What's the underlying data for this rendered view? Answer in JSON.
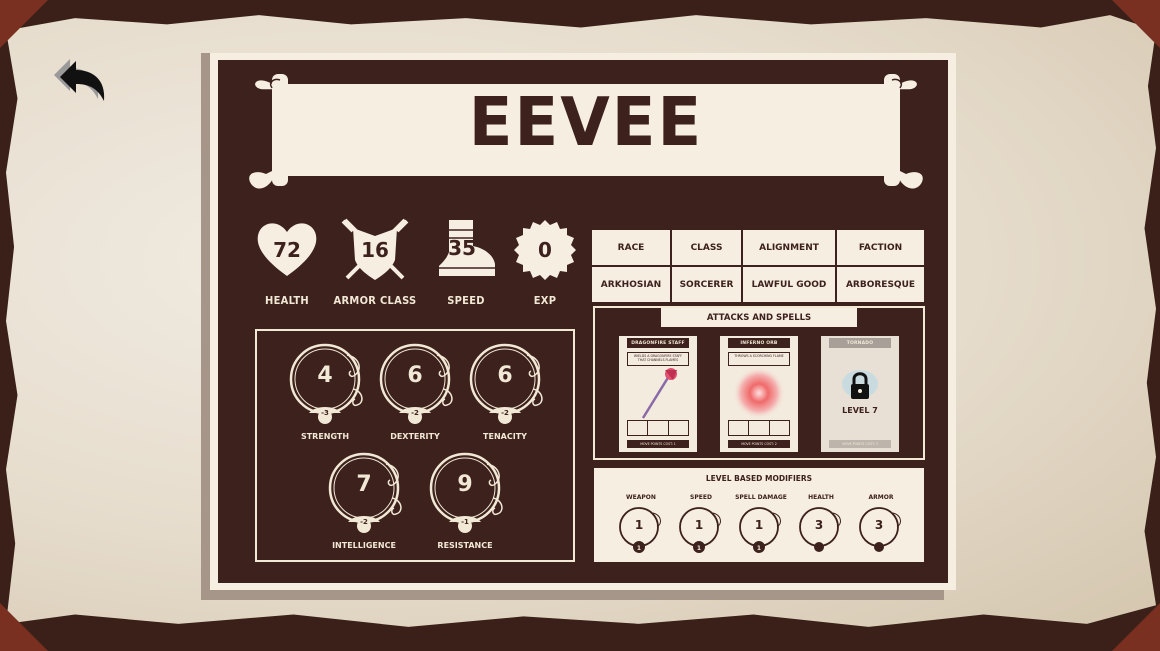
{
  "character": {
    "name": "EEVEE"
  },
  "stats": [
    {
      "key": "health",
      "value": "72",
      "label": "HEALTH"
    },
    {
      "key": "armor_class",
      "value": "16",
      "label": "ARMOR CLASS"
    },
    {
      "key": "speed",
      "value": "35",
      "label": "SPEED"
    },
    {
      "key": "exp",
      "value": "0",
      "label": "EXP"
    }
  ],
  "info": {
    "headers": [
      "RACE",
      "CLASS",
      "ALIGNMENT",
      "FACTION"
    ],
    "values": [
      "ARKHOSIAN",
      "SORCERER",
      "LAWFUL GOOD",
      "ARBORESQUE"
    ]
  },
  "attributes": [
    {
      "label": "STRENGTH",
      "value": "4",
      "modifier": "-3"
    },
    {
      "label": "DEXTERITY",
      "value": "6",
      "modifier": "-2"
    },
    {
      "label": "TENACITY",
      "value": "6",
      "modifier": "-2"
    },
    {
      "label": "INTELLIGENCE",
      "value": "7",
      "modifier": "-2"
    },
    {
      "label": "RESISTANCE",
      "value": "9",
      "modifier": "-1"
    }
  ],
  "spells": {
    "title": "ATTACKS AND SPELLS",
    "cards": [
      {
        "name": "DRAGONFIRE STAFF",
        "desc": "WIELDS A DRAGONFIRE STAFF THAT CHANNELS FLAMES",
        "footer": "MOVE POINTS COST: 1",
        "locked": false
      },
      {
        "name": "INFERNO ORB",
        "desc": "THROWS A SCORCHING FLAME",
        "footer": "MOVE POINTS COST: 2",
        "locked": false
      },
      {
        "name": "TORNADO",
        "desc": "",
        "footer": "MOVE POINTS COST: 3",
        "locked": true,
        "unlock_level": "LEVEL 7"
      }
    ]
  },
  "level_modifiers": {
    "title": "LEVEL BASED MODIFIERS",
    "items": [
      {
        "label": "WEAPON",
        "value": "1",
        "modifier": "1"
      },
      {
        "label": "SPEED",
        "value": "1",
        "modifier": "1"
      },
      {
        "label": "SPELL DAMAGE",
        "value": "1",
        "modifier": "1"
      },
      {
        "label": "HEALTH",
        "value": "3",
        "modifier": ""
      },
      {
        "label": "ARMOR",
        "value": "3",
        "modifier": ""
      }
    ]
  },
  "icons": {
    "back": "undo-arrow-icon",
    "health": "heart-icon",
    "armor_class": "shield-swords-icon",
    "speed": "boot-icon",
    "exp": "seal-badge-icon",
    "lock": "lock-icon"
  },
  "colors": {
    "dark": "#3d211c",
    "cream": "#f6eee0",
    "leather": "#7a3020"
  }
}
